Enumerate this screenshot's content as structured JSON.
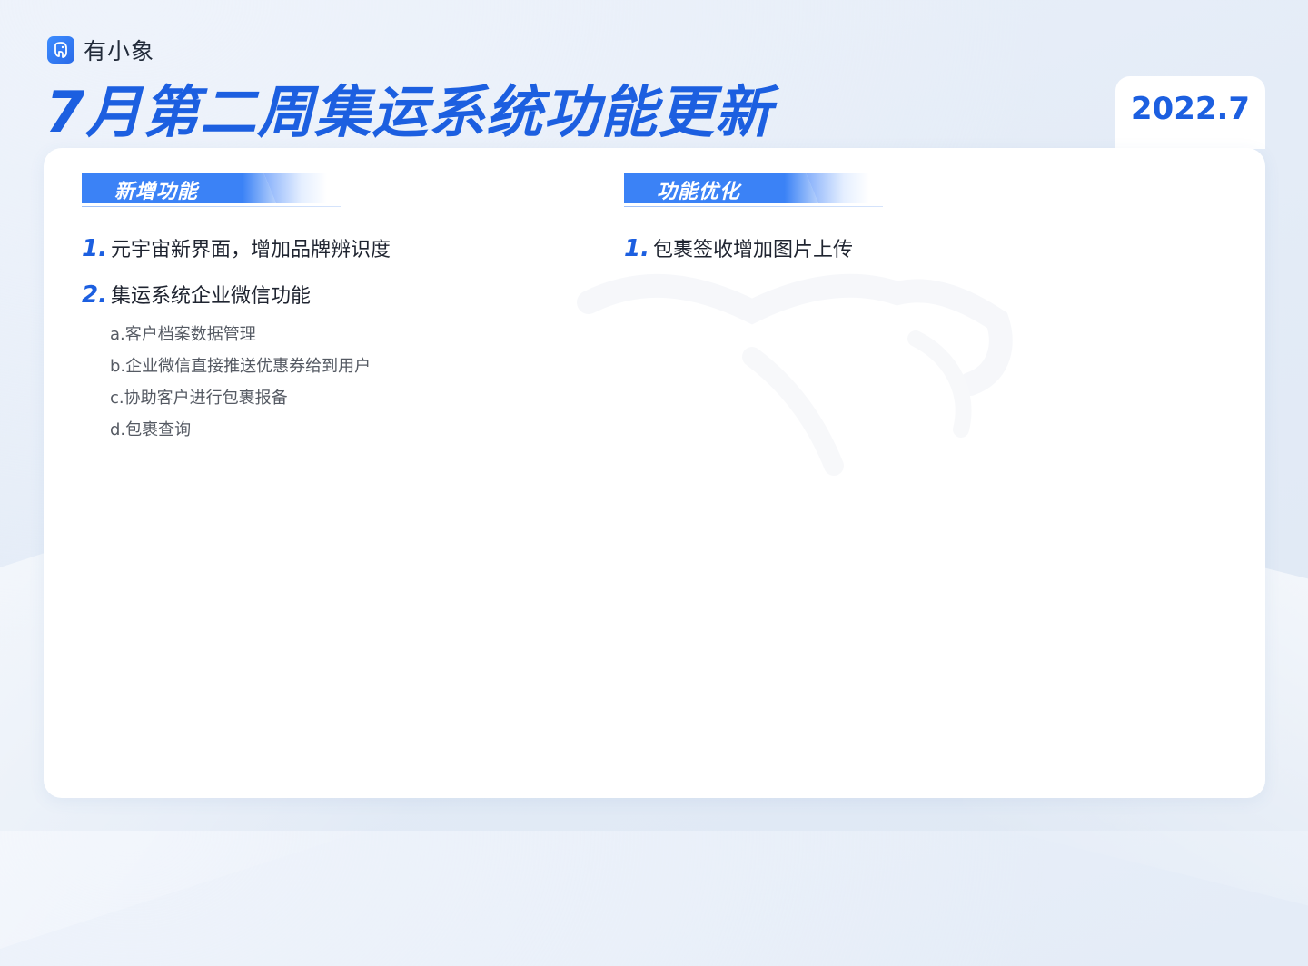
{
  "brand": {
    "name": "有小象",
    "icon": "elephant-logo-icon"
  },
  "title": "7月第二周集运系统功能更新",
  "date": "2022.7",
  "colors": {
    "accent": "#1c5fe0",
    "section_bar": "#3b82f6",
    "body_text": "#1f2430",
    "sub_text": "#555a63"
  },
  "sections": [
    {
      "label": "新增功能",
      "items": [
        {
          "num": "1.",
          "text": "元宇宙新界面，增加品牌辨识度",
          "subitems": []
        },
        {
          "num": "2.",
          "text": "集运系统企业微信功能",
          "subitems": [
            "a.客户档案数据管理",
            "b.企业微信直接推送优惠券给到用户",
            "c.协助客户进行包裹报备",
            "d.包裹查询"
          ]
        }
      ]
    },
    {
      "label": "功能优化",
      "items": [
        {
          "num": "1.",
          "text": "包裹签收增加图片上传",
          "subitems": []
        }
      ]
    }
  ]
}
